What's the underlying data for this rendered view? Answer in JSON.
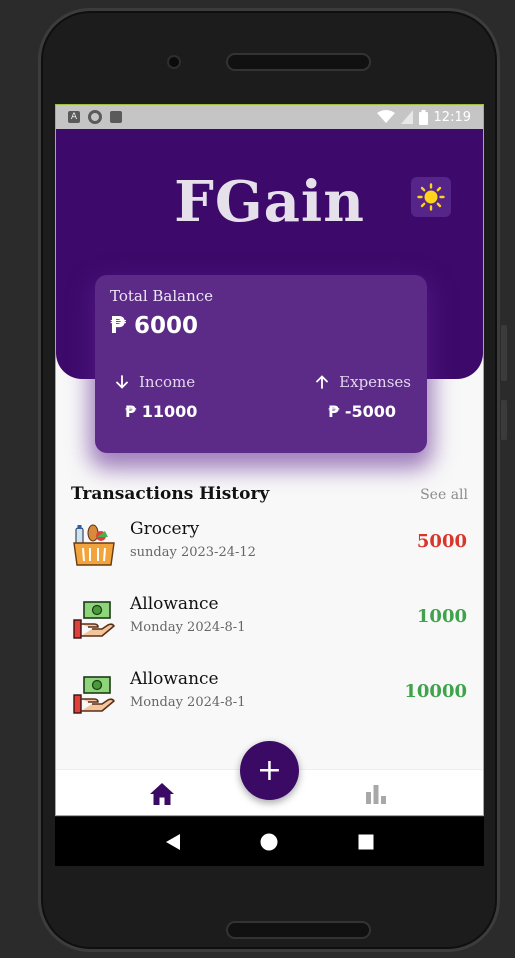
{
  "statusbar": {
    "time": "12:19",
    "icons": [
      "a-notification-icon",
      "record-icon",
      "sd-card-icon",
      "wifi-icon",
      "signal-icon",
      "battery-icon"
    ]
  },
  "app": {
    "title": "FGain",
    "theme_icon": "sun-icon",
    "accent_color": "#3d0a6b",
    "card_color": "#5b2b87"
  },
  "balance": {
    "label": "Total Balance",
    "value": "₱ 6000",
    "income_label": "Income",
    "income_value": "₱ 11000",
    "expenses_label": "Expenses",
    "expenses_value": "₱ -5000"
  },
  "history": {
    "title": "Transactions History",
    "see_all": "See all",
    "items": [
      {
        "name": "Grocery",
        "date": "sunday 2023-24-12",
        "amount": "5000",
        "color": "#d9362b",
        "icon": "grocery-basket-icon"
      },
      {
        "name": "Allowance",
        "date": "Monday 2024-8-1",
        "amount": "1000",
        "color": "#3ea34b",
        "icon": "cash-hand-icon"
      },
      {
        "name": "Allowance",
        "date": "Monday 2024-8-1",
        "amount": "10000",
        "color": "#3ea34b",
        "icon": "cash-hand-icon"
      }
    ]
  },
  "bottomnav": {
    "fab_label": "+",
    "home_icon": "home-icon",
    "stats_icon": "bar-chart-icon"
  },
  "androidnav": {
    "icons": [
      "back-icon",
      "home-circle-icon",
      "recents-icon"
    ]
  }
}
